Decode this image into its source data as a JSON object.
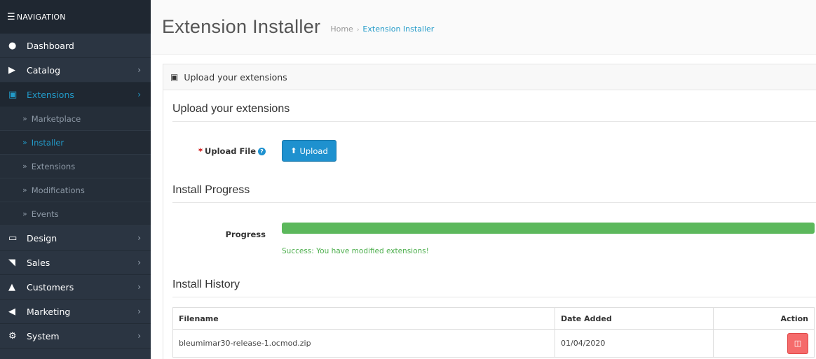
{
  "sidebar": {
    "header": "NAVIGATION",
    "items": [
      {
        "label": "Dashboard",
        "icon": "dashboard-icon",
        "glyph": "●",
        "has_children": false
      },
      {
        "label": "Catalog",
        "icon": "tag-icon",
        "glyph": "▶",
        "has_children": true
      },
      {
        "label": "Extensions",
        "icon": "puzzle-icon",
        "glyph": "▣",
        "has_children": true,
        "active": true,
        "children": [
          {
            "label": "Marketplace"
          },
          {
            "label": "Installer",
            "active": true
          },
          {
            "label": "Extensions"
          },
          {
            "label": "Modifications"
          },
          {
            "label": "Events"
          }
        ]
      },
      {
        "label": "Design",
        "icon": "monitor-icon",
        "glyph": "▭",
        "has_children": true
      },
      {
        "label": "Sales",
        "icon": "cart-icon",
        "glyph": "◥",
        "has_children": true
      },
      {
        "label": "Customers",
        "icon": "user-icon",
        "glyph": "▲",
        "has_children": true
      },
      {
        "label": "Marketing",
        "icon": "share-icon",
        "glyph": "◀",
        "has_children": true
      },
      {
        "label": "System",
        "icon": "cog-icon",
        "glyph": "⚙",
        "has_children": true
      }
    ]
  },
  "header": {
    "title": "Extension Installer",
    "breadcrumb": {
      "home": "Home",
      "separator": "›",
      "current": "Extension Installer"
    }
  },
  "panel": {
    "heading": "Upload your extensions",
    "upload_section_title": "Upload your extensions",
    "upload_label": "Upload File",
    "upload_required_mark": "*",
    "upload_button": "Upload",
    "progress_section_title": "Install Progress",
    "progress_label": "Progress",
    "progress_percent": 100,
    "progress_message": "Success: You have modified extensions!",
    "history_section_title": "Install History",
    "history": {
      "columns": [
        "Filename",
        "Date Added",
        "Action"
      ],
      "rows": [
        {
          "filename": "bleumimar30-release-1.ocmod.zip",
          "date_added": "01/04/2020"
        }
      ]
    }
  },
  "colors": {
    "sidebar_bg": "#2b3542",
    "accent": "#229ac8",
    "primary_button": "#1e91cf",
    "success": "#5cb85c",
    "danger": "#f56b6b"
  }
}
